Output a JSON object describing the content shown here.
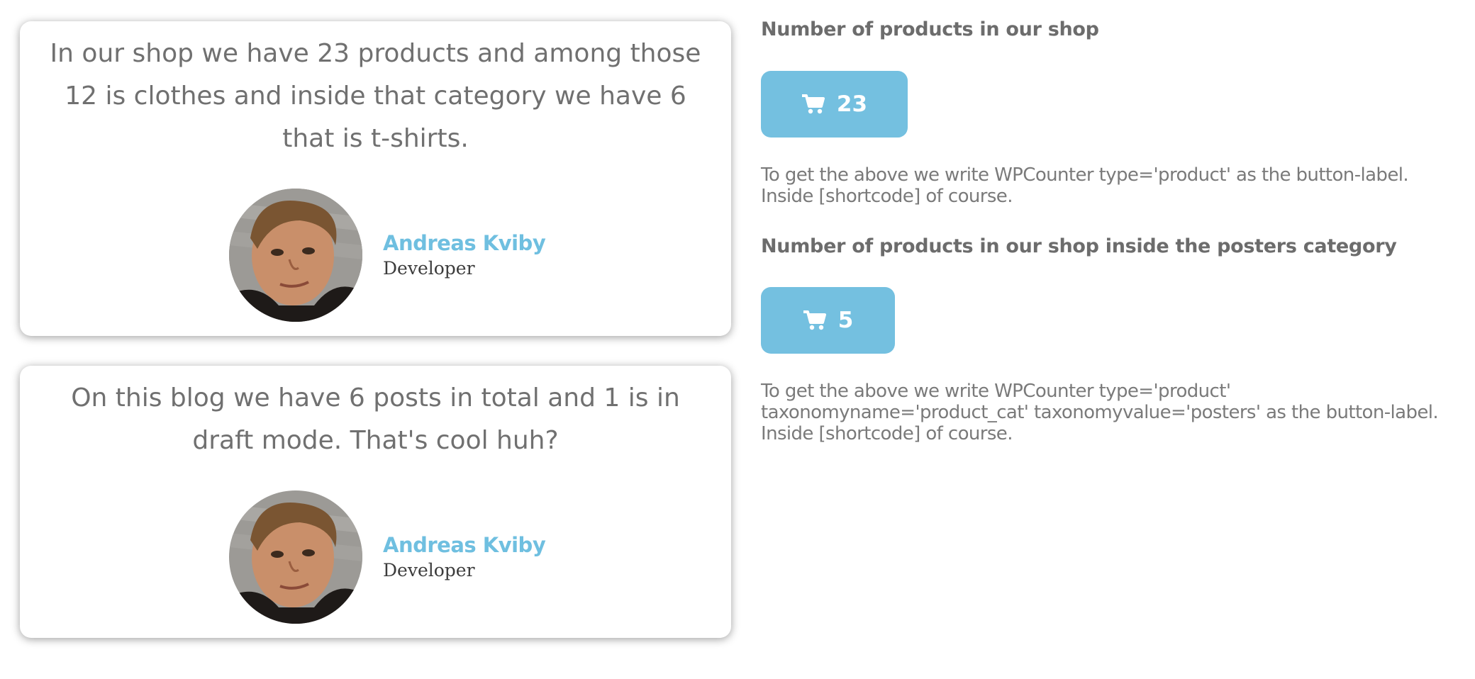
{
  "testimonials": [
    {
      "quote": "In our shop we have 23 products and among those 12 is clothes and inside that category we have 6 that is t-shirts.",
      "author_name": "Andreas Kviby",
      "author_role": "Developer"
    },
    {
      "quote": "On this blog we have 6 posts in total and 1 is in draft mode. That's cool huh?",
      "author_name": "Andreas Kviby",
      "author_role": "Developer"
    }
  ],
  "counters": [
    {
      "heading": "Number of products in our shop",
      "count": "23",
      "icon": "cart-icon",
      "description": "To get the above we write WPCounter type='product' as the button-label. Inside [shortcode] of course."
    },
    {
      "heading": "Number of products in our shop inside the posters category",
      "count": "5",
      "icon": "cart-icon",
      "description": "To get the above we write WPCounter type='product' taxonomyname='product_cat' taxonomyvalue='posters' as the button-label. Inside [shortcode] of course."
    }
  ],
  "colors": {
    "accent": "#74c0e0",
    "author_name": "#6fbfe0",
    "text_gray": "#707070"
  }
}
